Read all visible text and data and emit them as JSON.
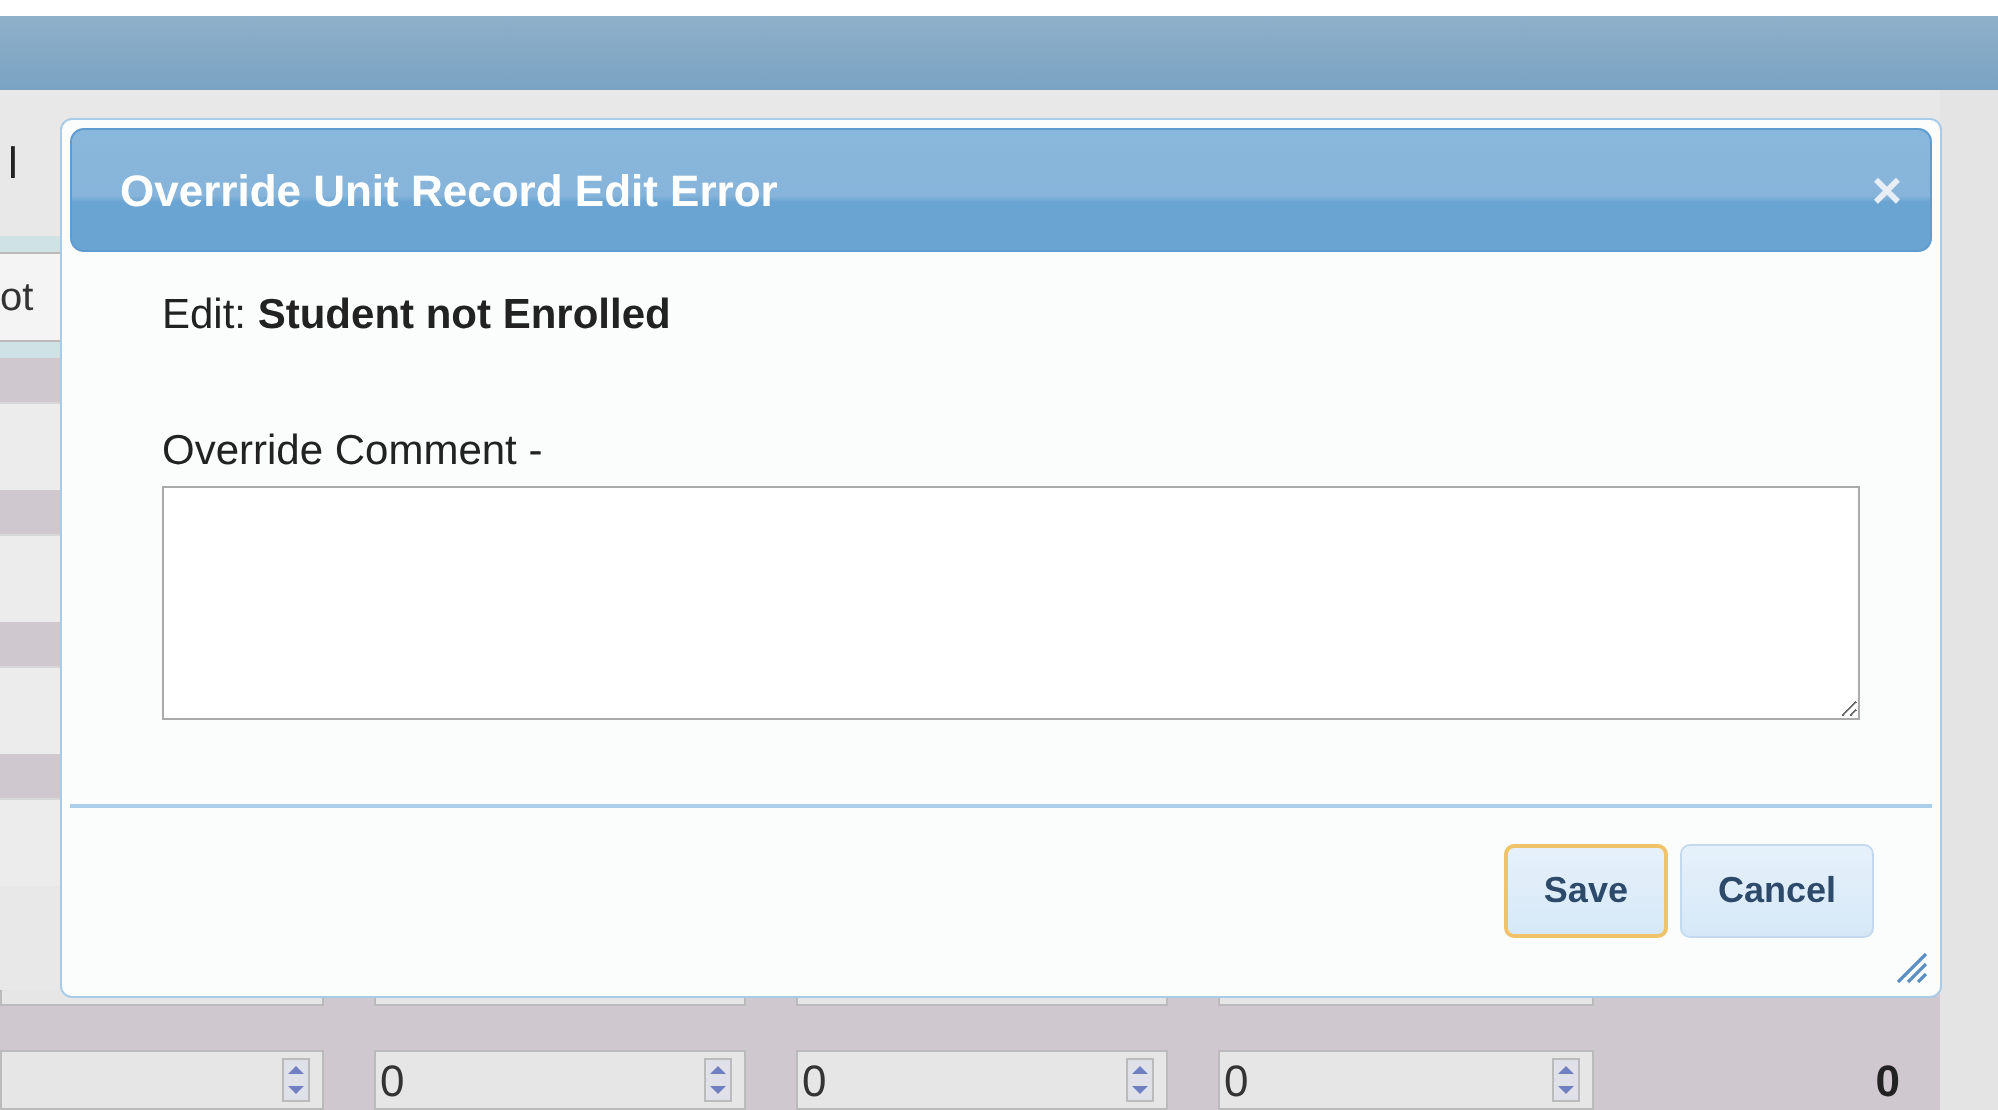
{
  "background": {
    "column_label": "l",
    "cell": "ot",
    "spin_fields": [
      {
        "kind": "empty"
      },
      {
        "kind": "number",
        "value": "0"
      },
      {
        "kind": "number",
        "value": "0"
      },
      {
        "kind": "number",
        "value": "0"
      }
    ],
    "total": "0"
  },
  "dialog": {
    "title": "Override Unit Record Edit Error",
    "close": "×",
    "edit_line": "Edit: **Student not Enrolled**",
    "comment_label": "Override Comment -",
    "buttons": [
      {
        "label": "Save",
        "focused": true
      },
      {
        "label": "Cancel",
        "focused": false
      }
    ]
  }
}
